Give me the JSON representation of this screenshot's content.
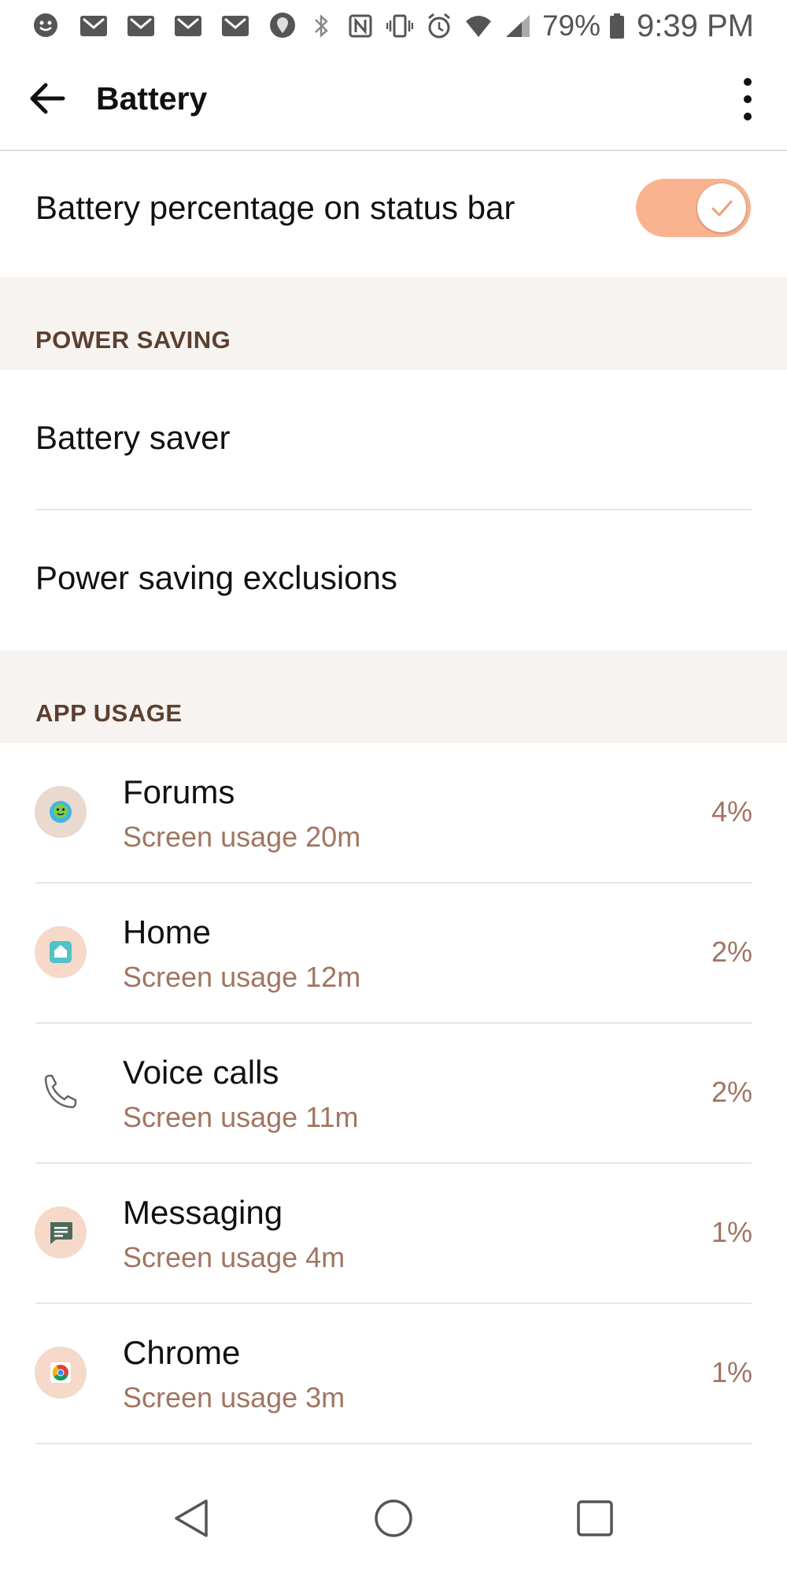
{
  "status_bar": {
    "left_icons": [
      "messenger-icon",
      "gmail-icon",
      "gmail-icon",
      "gmail-icon",
      "gmail-icon",
      "maps-icon"
    ],
    "right_icons": [
      "bluetooth-icon",
      "nfc-icon",
      "vibrate-icon",
      "alarm-icon",
      "wifi-icon",
      "signal-icon",
      "battery-icon"
    ],
    "battery_percent": "79%",
    "time": "9:39 PM"
  },
  "app_bar": {
    "title": "Battery"
  },
  "toggle_row": {
    "label": "Battery percentage on status bar",
    "on": true
  },
  "sections": {
    "power_saving": {
      "header": "POWER SAVING",
      "items": [
        "Battery saver",
        "Power saving exclusions"
      ]
    },
    "app_usage": {
      "header": "APP USAGE",
      "apps": [
        {
          "name": "Forums",
          "usage": "Screen usage 20m",
          "percent": "4%",
          "icon": "forums-icon"
        },
        {
          "name": "Home",
          "usage": "Screen usage 12m",
          "percent": "2%",
          "icon": "home-icon"
        },
        {
          "name": "Voice calls",
          "usage": "Screen usage 11m",
          "percent": "2%",
          "icon": "phone-icon"
        },
        {
          "name": "Messaging",
          "usage": "Screen usage 4m",
          "percent": "1%",
          "icon": "messaging-icon"
        },
        {
          "name": "Chrome",
          "usage": "Screen usage 3m",
          "percent": "1%",
          "icon": "chrome-icon"
        }
      ]
    }
  },
  "colors": {
    "accent": "#f9b38f",
    "secondary_text": "#a17562",
    "section_bg": "#f7f3f1",
    "header_text": "#5b4030"
  }
}
